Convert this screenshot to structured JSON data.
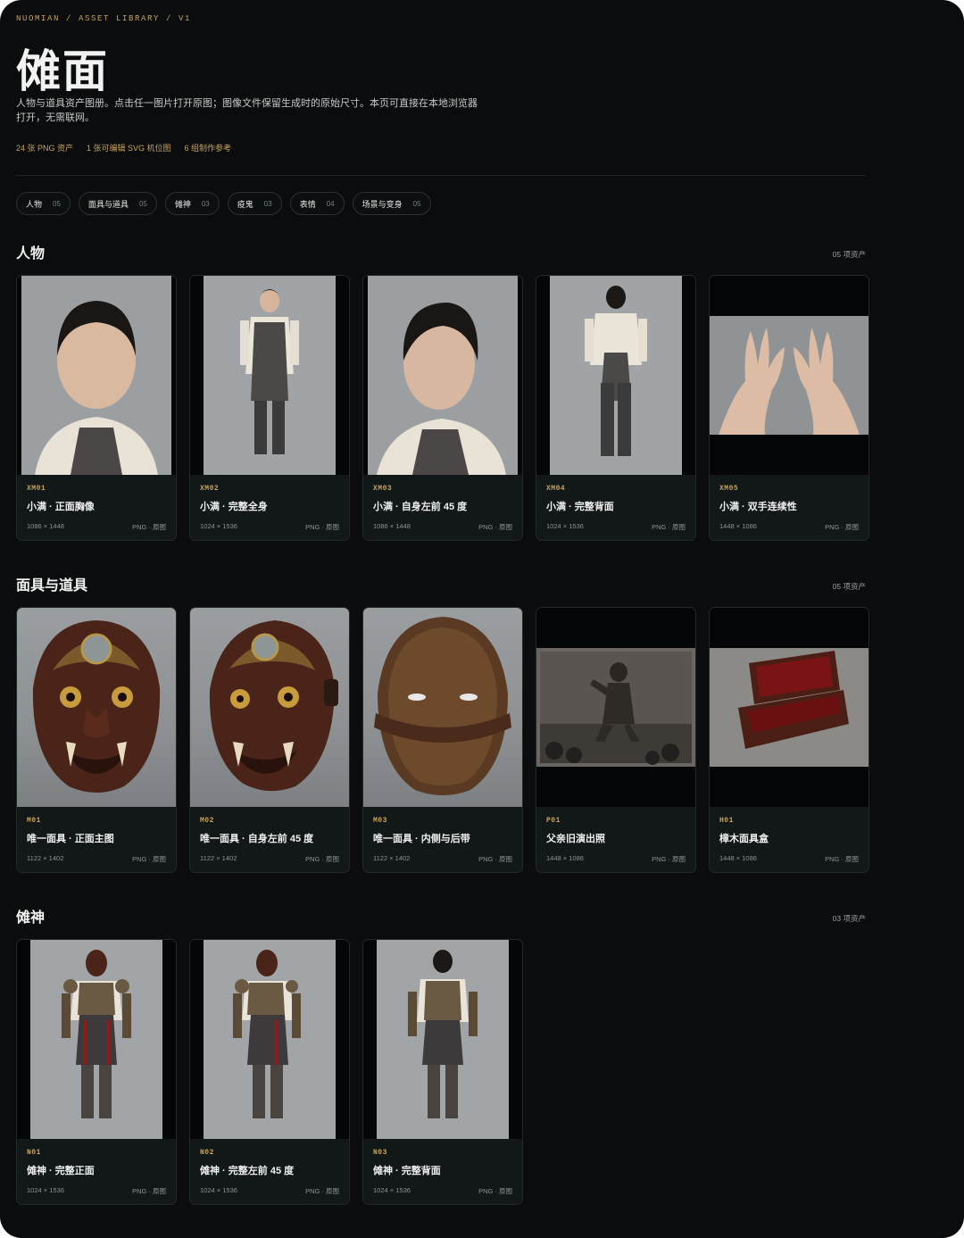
{
  "header": {
    "breadcrumb": "NUOMIAN / ASSET LIBRARY / V1",
    "title": "傩面",
    "description": "人物与道具资产图册。点击任一图片打开原图；图像文件保留生成时的原始尺寸。本页可直接在本地浏览器打开，无需联网。",
    "stats": [
      "24 张 PNG 资产",
      "1 张可编辑 SVG 机位图",
      "6 组制作参考"
    ]
  },
  "filters": [
    {
      "label": "人物",
      "count": "05"
    },
    {
      "label": "面具与道具",
      "count": "05"
    },
    {
      "label": "傩神",
      "count": "03"
    },
    {
      "label": "疫鬼",
      "count": "03"
    },
    {
      "label": "表情",
      "count": "04"
    },
    {
      "label": "场景与变身",
      "count": "05"
    }
  ],
  "sections": [
    {
      "title": "人物",
      "count": "05 项资产",
      "cards": [
        {
          "code": "XM01",
          "name": "小满 · 正面胸像",
          "dims": "1086 × 1448",
          "fmt": "PNG · 原图"
        },
        {
          "code": "XM02",
          "name": "小满 · 完整全身",
          "dims": "1024 × 1536",
          "fmt": "PNG · 原图"
        },
        {
          "code": "XM03",
          "name": "小满 · 自身左前 45 度",
          "dims": "1086 × 1448",
          "fmt": "PNG · 原图"
        },
        {
          "code": "XM04",
          "name": "小满 · 完整背面",
          "dims": "1024 × 1536",
          "fmt": "PNG · 原图"
        },
        {
          "code": "XM05",
          "name": "小满 · 双手连续性",
          "dims": "1448 × 1086",
          "fmt": "PNG · 原图"
        }
      ]
    },
    {
      "title": "面具与道具",
      "count": "05 项资产",
      "cards": [
        {
          "code": "M01",
          "name": "唯一面具 · 正面主图",
          "dims": "1122 × 1402",
          "fmt": "PNG · 原图"
        },
        {
          "code": "M02",
          "name": "唯一面具 · 自身左前 45 度",
          "dims": "1122 × 1402",
          "fmt": "PNG · 原图"
        },
        {
          "code": "M03",
          "name": "唯一面具 · 内侧与后带",
          "dims": "1122 × 1402",
          "fmt": "PNG · 原图"
        },
        {
          "code": "P01",
          "name": "父亲旧演出照",
          "dims": "1448 × 1086",
          "fmt": "PNG · 原图"
        },
        {
          "code": "H01",
          "name": "樟木面具盒",
          "dims": "1448 × 1086",
          "fmt": "PNG · 原图"
        }
      ]
    },
    {
      "title": "傩神",
      "count": "03 项资产",
      "cards": [
        {
          "code": "N01",
          "name": "傩神 · 完整正面",
          "dims": "1024 × 1536",
          "fmt": "PNG · 原图"
        },
        {
          "code": "N02",
          "name": "傩神 · 完整左前 45 度",
          "dims": "1024 × 1536",
          "fmt": "PNG · 原图"
        },
        {
          "code": "N03",
          "name": "傩神 · 完整背面",
          "dims": "1024 × 1536",
          "fmt": "PNG · 原图"
        }
      ]
    }
  ],
  "colors": {
    "accent": "#c9a45c",
    "background": "#0a0c0d",
    "card": "#121718"
  }
}
